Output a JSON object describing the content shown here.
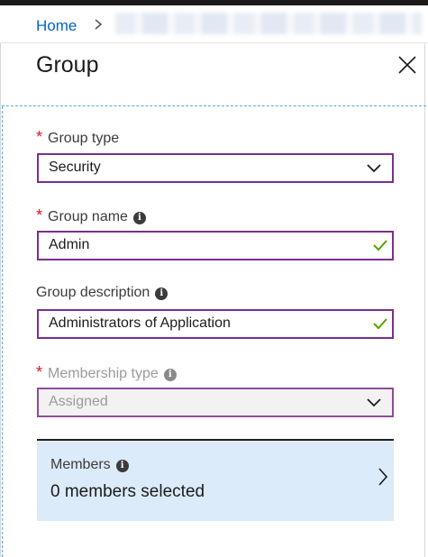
{
  "breadcrumb": {
    "home_label": "Home"
  },
  "blade": {
    "title": "Group"
  },
  "form": {
    "group_type": {
      "label": "Group type",
      "value": "Security"
    },
    "group_name": {
      "label": "Group name",
      "value": "Admin"
    },
    "group_description": {
      "label": "Group description",
      "value": "Administrators of Application"
    },
    "membership_type": {
      "label": "Membership type",
      "value": "Assigned"
    },
    "required_marker": "*",
    "info_glyph": "i"
  },
  "members": {
    "label": "Members",
    "value": "0 members selected"
  },
  "colors": {
    "accent_border": "#7a2f8e",
    "link": "#0064c8",
    "required": "#e81123",
    "valid_check": "#57a300",
    "members_bg": "#dcebfa"
  },
  "icons": [
    "chevron-right-icon",
    "close-icon",
    "chevron-down-icon",
    "checkmark-icon",
    "info-icon"
  ]
}
